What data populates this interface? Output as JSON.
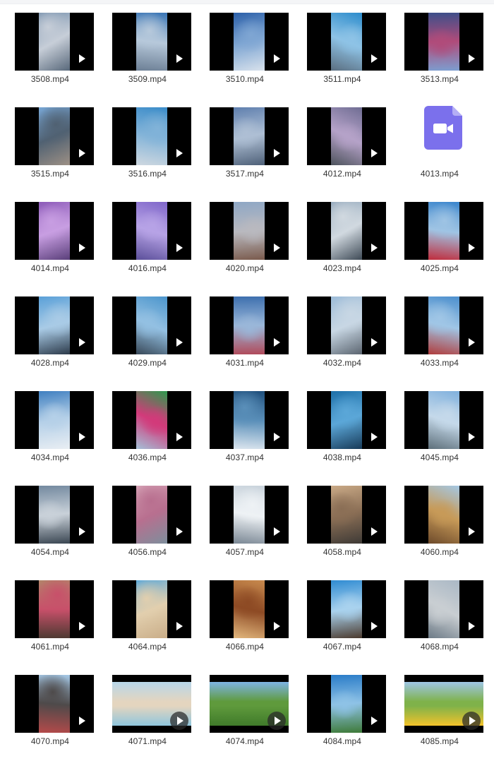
{
  "files": [
    {
      "name": "3508.mp4",
      "has_thumbnail": true,
      "orientation": "portrait",
      "palette": [
        "#6a87a6",
        "#c7ced8",
        "#58687a"
      ]
    },
    {
      "name": "3509.mp4",
      "has_thumbnail": true,
      "orientation": "portrait",
      "palette": [
        "#3a75b5",
        "#b7c9db",
        "#6c7f95"
      ]
    },
    {
      "name": "3510.mp4",
      "has_thumbnail": true,
      "orientation": "portrait",
      "palette": [
        "#2b5fa8",
        "#7fa6d3",
        "#d9e2ec"
      ]
    },
    {
      "name": "3511.mp4",
      "has_thumbnail": true,
      "orientation": "portrait",
      "palette": [
        "#2c8ccc",
        "#8ec3e6",
        "#5b6e80"
      ]
    },
    {
      "name": "3513.mp4",
      "has_thumbnail": true,
      "orientation": "portrait",
      "palette": [
        "#3c4f8a",
        "#b04b7a",
        "#7c9ed0"
      ]
    },
    {
      "name": "3515.mp4",
      "has_thumbnail": true,
      "orientation": "portrait",
      "palette": [
        "#78a7d6",
        "#506172",
        "#9d9085"
      ]
    },
    {
      "name": "3516.mp4",
      "has_thumbnail": true,
      "orientation": "portrait",
      "palette": [
        "#3b8cc9",
        "#82b3d8",
        "#cfd8e0"
      ]
    },
    {
      "name": "3517.mp4",
      "has_thumbnail": true,
      "orientation": "portrait",
      "palette": [
        "#5f7fae",
        "#aebfd4",
        "#4e6078"
      ]
    },
    {
      "name": "4012.mp4",
      "has_thumbnail": true,
      "orientation": "portrait",
      "palette": [
        "#6f6d93",
        "#b5a2c8",
        "#4d535c"
      ]
    },
    {
      "name": "4013.mp4",
      "has_thumbnail": false,
      "orientation": "none",
      "palette": []
    },
    {
      "name": "4014.mp4",
      "has_thumbnail": true,
      "orientation": "portrait",
      "palette": [
        "#8c5ab8",
        "#c89ee2",
        "#5a3f7a"
      ]
    },
    {
      "name": "4016.mp4",
      "has_thumbnail": true,
      "orientation": "portrait",
      "palette": [
        "#7f66c9",
        "#b7a3e6",
        "#5b4f9a"
      ]
    },
    {
      "name": "4020.mp4",
      "has_thumbnail": true,
      "orientation": "portrait",
      "palette": [
        "#8ea7c5",
        "#b9b9bf",
        "#7a5a4c"
      ]
    },
    {
      "name": "4023.mp4",
      "has_thumbnail": true,
      "orientation": "portrait",
      "palette": [
        "#8da3b8",
        "#d1d9e0",
        "#3e4a56"
      ]
    },
    {
      "name": "4025.mp4",
      "has_thumbnail": true,
      "orientation": "portrait",
      "palette": [
        "#3a85cc",
        "#9fc4e4",
        "#c02c3c"
      ]
    },
    {
      "name": "4028.mp4",
      "has_thumbnail": true,
      "orientation": "portrait",
      "palette": [
        "#5aa0d8",
        "#a9cbe6",
        "#2c3a4a"
      ]
    },
    {
      "name": "4029.mp4",
      "has_thumbnail": true,
      "orientation": "portrait",
      "palette": [
        "#4b95cc",
        "#93c0e2",
        "#384858"
      ]
    },
    {
      "name": "4031.mp4",
      "has_thumbnail": true,
      "orientation": "portrait",
      "palette": [
        "#3d6fae",
        "#9ab7d9",
        "#b04a5a"
      ]
    },
    {
      "name": "4032.mp4",
      "has_thumbnail": true,
      "orientation": "portrait",
      "palette": [
        "#9dbcd8",
        "#c8d7e4",
        "#5b6570"
      ]
    },
    {
      "name": "4033.mp4",
      "has_thumbnail": true,
      "orientation": "portrait",
      "palette": [
        "#4c8fcd",
        "#a0c6e6",
        "#b03c3c"
      ]
    },
    {
      "name": "4034.mp4",
      "has_thumbnail": true,
      "orientation": "portrait",
      "palette": [
        "#3f7fc0",
        "#b5d0e8",
        "#e9eef3"
      ]
    },
    {
      "name": "4036.mp4",
      "has_thumbnail": true,
      "orientation": "portrait",
      "palette": [
        "#2c9a4c",
        "#d23a7a",
        "#a4c0d8"
      ]
    },
    {
      "name": "4037.mp4",
      "has_thumbnail": true,
      "orientation": "portrait",
      "palette": [
        "#1f4f7c",
        "#5a8fb9",
        "#dbe5ee"
      ]
    },
    {
      "name": "4038.mp4",
      "has_thumbnail": true,
      "orientation": "portrait",
      "palette": [
        "#1d6fa8",
        "#5ba7d8",
        "#173a58"
      ]
    },
    {
      "name": "4045.mp4",
      "has_thumbnail": true,
      "orientation": "portrait",
      "palette": [
        "#7fb0dd",
        "#c5d9ea",
        "#5d6f7a"
      ]
    },
    {
      "name": "4054.mp4",
      "has_thumbnail": true,
      "orientation": "portrait",
      "palette": [
        "#73899f",
        "#c9d1d9",
        "#3a4652"
      ]
    },
    {
      "name": "4056.mp4",
      "has_thumbnail": true,
      "orientation": "portrait",
      "palette": [
        "#d7a5b7",
        "#b86f8f",
        "#7d8e9c"
      ]
    },
    {
      "name": "4057.mp4",
      "has_thumbnail": true,
      "orientation": "portrait",
      "palette": [
        "#c8d2db",
        "#eef2f5",
        "#7a8794"
      ]
    },
    {
      "name": "4058.mp4",
      "has_thumbnail": true,
      "orientation": "portrait",
      "palette": [
        "#c9a986",
        "#8a6e55",
        "#3e3a36"
      ]
    },
    {
      "name": "4060.mp4",
      "has_thumbnail": true,
      "orientation": "portrait",
      "palette": [
        "#a4c8e4",
        "#c79a58",
        "#6d4a2b"
      ]
    },
    {
      "name": "4061.mp4",
      "has_thumbnail": true,
      "orientation": "portrait",
      "palette": [
        "#b2846a",
        "#c8506a",
        "#4e3a32"
      ]
    },
    {
      "name": "4064.mp4",
      "has_thumbnail": true,
      "orientation": "portrait",
      "palette": [
        "#58a7da",
        "#e2cfae",
        "#c9ad88"
      ]
    },
    {
      "name": "4066.mp4",
      "has_thumbnail": true,
      "orientation": "portrait",
      "palette": [
        "#c88a4e",
        "#8d4a24",
        "#e2b77d"
      ]
    },
    {
      "name": "4067.mp4",
      "has_thumbnail": true,
      "orientation": "portrait",
      "palette": [
        "#2f8bd2",
        "#a9d2ee",
        "#4b3a2e"
      ]
    },
    {
      "name": "4068.mp4",
      "has_thumbnail": true,
      "orientation": "portrait",
      "palette": [
        "#aab8c5",
        "#c9ced2",
        "#6c7a86"
      ]
    },
    {
      "name": "4070.mp4",
      "has_thumbnail": true,
      "orientation": "portrait",
      "palette": [
        "#a5c8e6",
        "#4e4a4a",
        "#b54a4a"
      ]
    },
    {
      "name": "4071.mp4",
      "has_thumbnail": true,
      "orientation": "landscape",
      "palette": [
        "#b8d7ea",
        "#e4d5bf",
        "#8fc6dd"
      ]
    },
    {
      "name": "4074.mp4",
      "has_thumbnail": true,
      "orientation": "landscape",
      "palette": [
        "#7eb4e4",
        "#5f9a3c",
        "#3f7a2a"
      ]
    },
    {
      "name": "4084.mp4",
      "has_thumbnail": true,
      "orientation": "portrait",
      "palette": [
        "#2a7cc8",
        "#8ec2e6",
        "#3e7a38"
      ]
    },
    {
      "name": "4085.mp4",
      "has_thumbnail": true,
      "orientation": "landscape",
      "palette": [
        "#9fc6e6",
        "#7fb24a",
        "#f2c22a"
      ]
    }
  ],
  "video_file_icon": {
    "color": "#7b70ec",
    "fold_color": "#b4aef5",
    "glyph": "video-camera"
  }
}
